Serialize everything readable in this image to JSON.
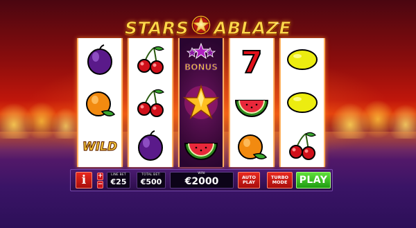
{
  "game": {
    "logo_left": "STARS",
    "logo_right": "ABLAZE",
    "trademark": "™"
  },
  "reels": [
    {
      "symbols": [
        {
          "name": "plum-icon"
        },
        {
          "name": "orange-icon"
        },
        {
          "name": "wild-icon",
          "text": "WILD"
        }
      ]
    },
    {
      "symbols": [
        {
          "name": "cherries-icon"
        },
        {
          "name": "cherries-icon"
        },
        {
          "name": "plum-icon"
        }
      ]
    },
    {
      "symbols": [
        {
          "name": "bonus-icon",
          "text": "BONUS"
        },
        {
          "name": "star-icon"
        },
        {
          "name": "watermelon-icon"
        }
      ]
    },
    {
      "symbols": [
        {
          "name": "seven-icon",
          "text": "7"
        },
        {
          "name": "watermelon-icon"
        },
        {
          "name": "orange-icon"
        }
      ]
    },
    {
      "symbols": [
        {
          "name": "lemon-icon"
        },
        {
          "name": "lemon-icon"
        },
        {
          "name": "cherries-icon"
        }
      ]
    }
  ],
  "controls": {
    "info_label": "i",
    "plus_label": "+",
    "minus_label": "−",
    "line_bet_label": "LINE BET",
    "line_bet_value": "€25",
    "total_bet_label": "TOTAL BET:",
    "total_bet_value": "€500",
    "win_label": "WIN:",
    "win_value": "€2000",
    "auto_play_line1": "AUTO",
    "auto_play_line2": "PLAY",
    "turbo_line1": "TURBO",
    "turbo_line2": "MODE",
    "play_label": "PLAY"
  },
  "colors": {
    "accent_red": "#d81b16",
    "play_green": "#37c220",
    "logo_gold": "#ffd84a",
    "bar_purple": "#3a1360"
  }
}
